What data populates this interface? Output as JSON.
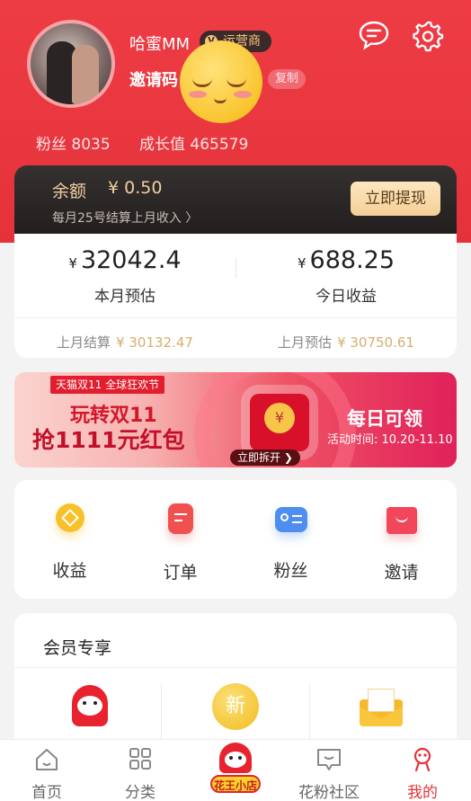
{
  "profile": {
    "username": "哈蜜MM",
    "role_badge": "运营商",
    "invite_label": "邀请码",
    "copy_label": "复制",
    "fans_label": "粉丝",
    "fans_count": "8035",
    "growth_label": "成长值",
    "growth_value": "465579"
  },
  "balance": {
    "label": "余额",
    "value": "¥ 0.50",
    "note": "每月25号结算上月收入 〉",
    "withdraw_label": "立即提现"
  },
  "earnings": {
    "month_estimate": {
      "currency": "¥",
      "value": "32042.4",
      "label": "本月预估"
    },
    "today_income": {
      "currency": "¥",
      "value": "688.25",
      "label": "今日收益"
    },
    "last_month_settle": {
      "label": "上月结算",
      "value": "¥ 30132.47"
    },
    "last_month_estimate": {
      "label": "上月预估",
      "value": "¥ 30750.61"
    }
  },
  "banner": {
    "tag": "天猫双11 全球狂欢节",
    "line1": "玩转双11",
    "line2": "抢1111元红包",
    "coin": "¥",
    "open_button": "立即拆开 ❯",
    "daily": "每日可领",
    "period": "活动时间: 10.20-11.10"
  },
  "quick_menu": [
    {
      "label": "收益",
      "icon": "earnings-icon",
      "color": "#f8c12b"
    },
    {
      "label": "订单",
      "icon": "order-icon",
      "color": "#f05050"
    },
    {
      "label": "粉丝",
      "icon": "fans-icon",
      "color": "#4e8ef0"
    },
    {
      "label": "邀请",
      "icon": "invite-icon",
      "color": "#f2465a"
    }
  ],
  "member": {
    "title": "会员专享",
    "new_badge": "新"
  },
  "nav": [
    {
      "label": "首页",
      "icon": "home-icon"
    },
    {
      "label": "分类",
      "icon": "category-icon"
    },
    {
      "label": "花王小店",
      "icon": "shop-icon"
    },
    {
      "label": "花粉社区",
      "icon": "community-icon"
    },
    {
      "label": "我的",
      "icon": "profile-icon"
    }
  ],
  "colors": {
    "brand_red": "#e8323c",
    "gold": "#f0cf9d",
    "active_nav": "#e53138"
  }
}
